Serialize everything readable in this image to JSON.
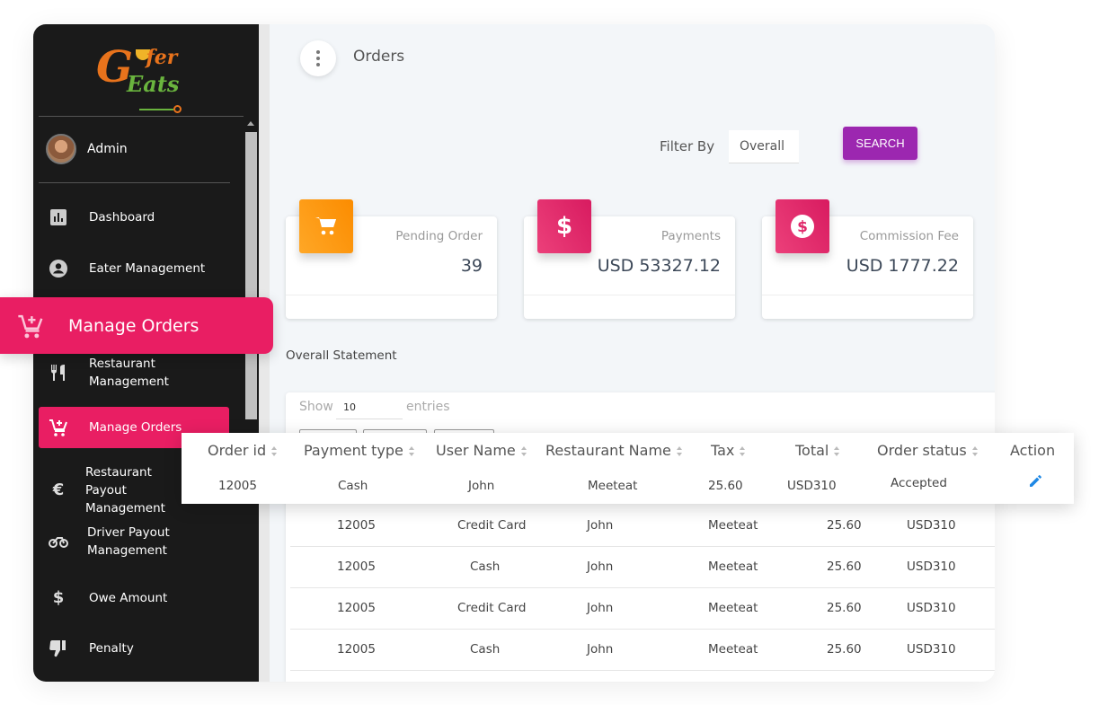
{
  "brand": {
    "logo_line1": "Gofer",
    "logo_line2": "Eats",
    "accent": "#e91e63",
    "search_color": "#9c27b0",
    "pending_color": "#ff9800"
  },
  "user": {
    "name": "Admin"
  },
  "sidebar": {
    "items": [
      {
        "label": "Dashboard",
        "icon": "bar-chart-icon"
      },
      {
        "label": "Eater Management",
        "icon": "account-circle-icon"
      },
      {
        "label": "Restaurant Management",
        "icon": "restaurant-icon"
      },
      {
        "label": "Manage Orders",
        "icon": "cart-plus-icon",
        "active": true
      },
      {
        "label": "Restaurant Payout Management",
        "icon": "euro-icon"
      },
      {
        "label": "Driver Payout Management",
        "icon": "motorbike-icon"
      },
      {
        "label": "Owe Amount",
        "icon": "dollar-icon"
      },
      {
        "label": "Penalty",
        "icon": "thumb-down-icon"
      }
    ],
    "highlight_label": "Manage Orders"
  },
  "header": {
    "title": "Orders",
    "menu_icon": "more-vert-icon"
  },
  "filter": {
    "label": "Filter By",
    "value": "Overall",
    "search_label": "SEARCH"
  },
  "stats": [
    {
      "label": "Pending Order",
      "value": "39",
      "icon": "cart-icon"
    },
    {
      "label": "Payments",
      "value": "USD 53327.12",
      "icon": "dollar-icon"
    },
    {
      "label": "Commission Fee",
      "value": "USD 1777.22",
      "icon": "dollar-circle-icon"
    }
  ],
  "statement": {
    "title": "Overall Statement",
    "show_label": "Show",
    "page_size": "10",
    "entries_label": "entries"
  },
  "table": {
    "columns": [
      "Order id",
      "Payment type",
      "User Name",
      "Restaurant Name",
      "Tax",
      "Total",
      "Order status",
      "Action"
    ],
    "highlight_row": {
      "order_id": "12005",
      "payment_type": "Cash",
      "user_name": "John",
      "restaurant": "Meeteat",
      "tax": "25.60",
      "total": "USD310",
      "status": "Accepted",
      "action_icon": "edit-icon"
    },
    "rows": [
      {
        "order_id": "12005",
        "payment_type": "Credit Card",
        "user_name": "John",
        "restaurant": "Meeteat",
        "tax": "25.60",
        "total": "USD310"
      },
      {
        "order_id": "12005",
        "payment_type": "Cash",
        "user_name": "John",
        "restaurant": "Meeteat",
        "tax": "25.60",
        "total": "USD310"
      },
      {
        "order_id": "12005",
        "payment_type": "Credit Card",
        "user_name": "John",
        "restaurant": "Meeteat",
        "tax": "25.60",
        "total": "USD310"
      },
      {
        "order_id": "12005",
        "payment_type": "Cash",
        "user_name": "John",
        "restaurant": "Meeteat",
        "tax": "25.60",
        "total": "USD310"
      }
    ]
  }
}
